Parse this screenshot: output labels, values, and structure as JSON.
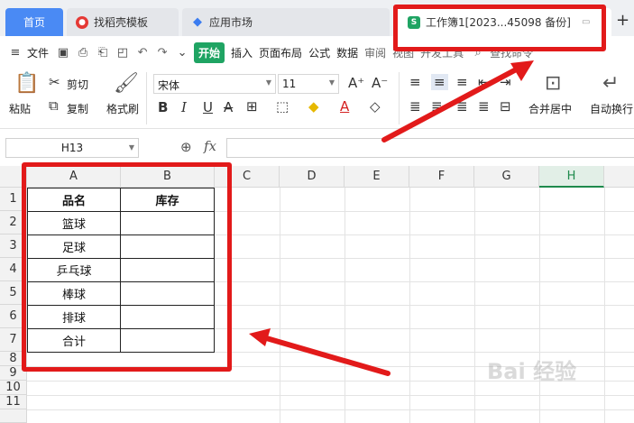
{
  "tabs": {
    "home": "首页",
    "docer": "找稻壳模板",
    "store": "应用市场",
    "workbook": "工作簿1[2023...45098 备份]",
    "sheet_icon": "S"
  },
  "menu": {
    "file": "文件",
    "start": "开始",
    "insert": "插入",
    "page_layout": "页面布局",
    "formula": "公式",
    "data": "数据",
    "review": "审阅",
    "view": "视图",
    "dev": "开发工具",
    "search": "查找命令"
  },
  "ribbon": {
    "paste": "粘贴",
    "cut": "剪切",
    "copy": "复制",
    "format_painter": "格式刷",
    "font_name": "宋体",
    "font_size": "11",
    "merge_center": "合并居中",
    "wrap_text": "自动换行"
  },
  "formula_bar": {
    "name_box": "H13",
    "fx": "fx",
    "formula": ""
  },
  "columns": [
    "A",
    "B",
    "C",
    "D",
    "E",
    "F",
    "G",
    "H"
  ],
  "active_column": "H",
  "rows": [
    "1",
    "2",
    "3",
    "4",
    "5",
    "6",
    "7",
    "8",
    "9",
    "10",
    "11"
  ],
  "table": {
    "header": [
      "品名",
      "库存"
    ],
    "items": [
      "篮球",
      "足球",
      "乒乓球",
      "棒球",
      "排球",
      "合计"
    ],
    "stock": [
      "",
      "",
      "",
      "",
      "",
      ""
    ]
  },
  "watermark": "Bai 经验",
  "colors": {
    "accent_green": "#1fa463",
    "highlight_red": "#e21a1a",
    "home_tab_blue": "#4a8af4"
  }
}
